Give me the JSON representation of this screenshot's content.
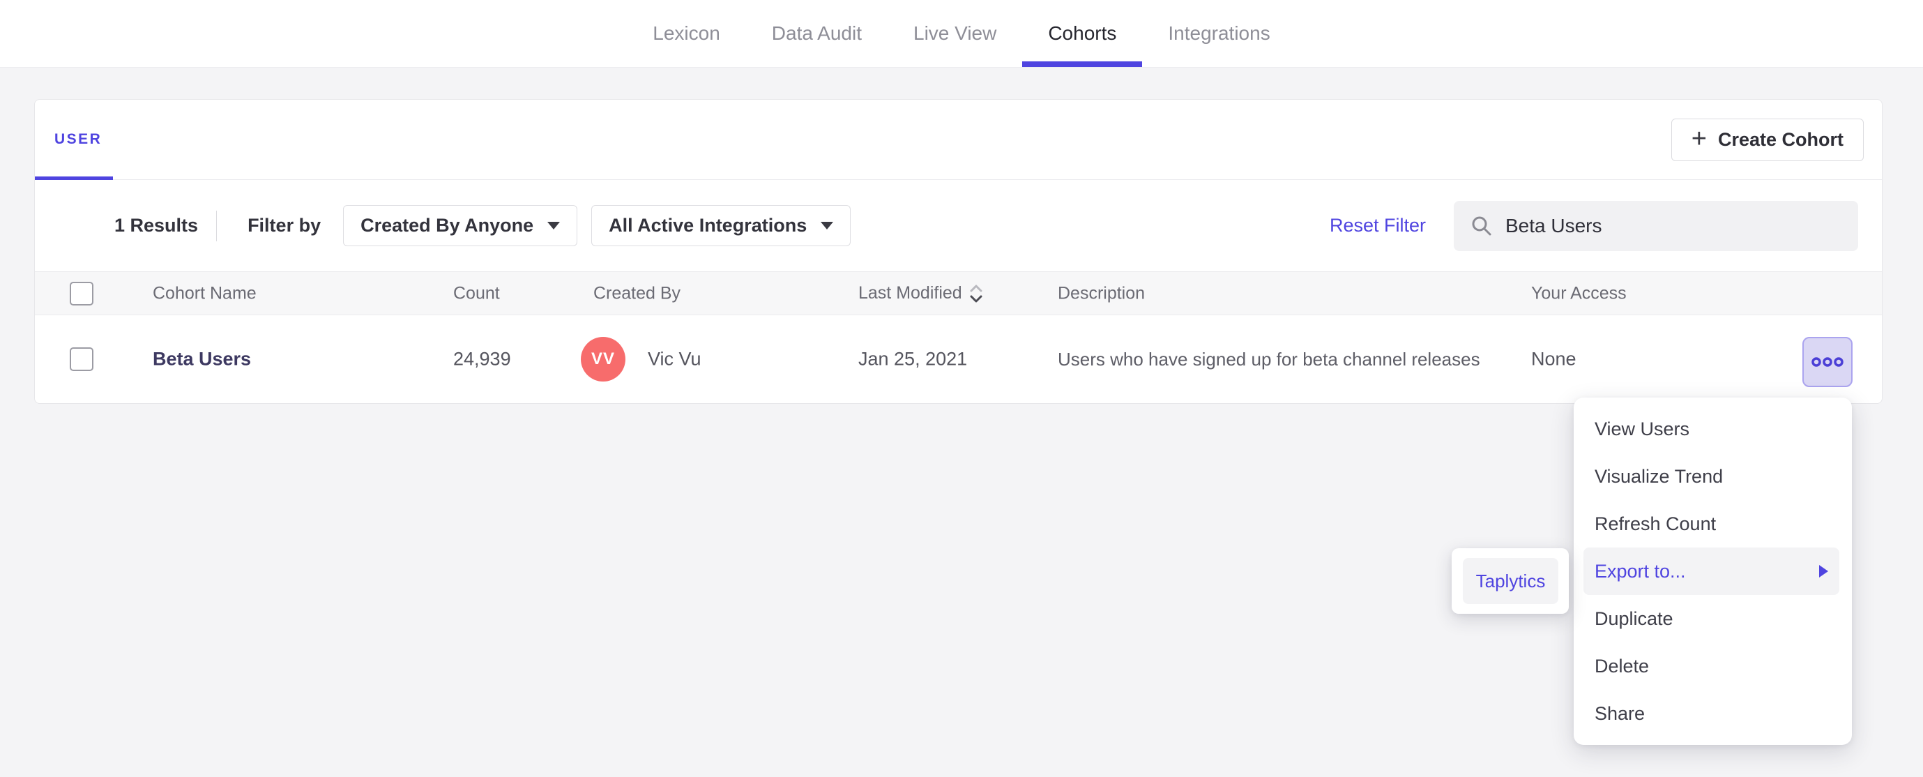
{
  "nav": {
    "tabs": [
      {
        "label": "Lexicon"
      },
      {
        "label": "Data Audit"
      },
      {
        "label": "Live View"
      },
      {
        "label": "Cohorts"
      },
      {
        "label": "Integrations"
      }
    ],
    "active_tab": "Cohorts"
  },
  "cohorts": {
    "tab_label": "USER",
    "create_button_label": "Create Cohort",
    "filters": {
      "results_count": "1 Results",
      "filter_by_label": "Filter by",
      "created_by_dropdown": "Created By Anyone",
      "integrations_dropdown": "All Active Integrations",
      "reset_filter_label": "Reset Filter",
      "search_value": "Beta Users"
    },
    "table": {
      "headers": {
        "cohort_name": "Cohort Name",
        "count": "Count",
        "created_by": "Created By",
        "last_modified": "Last Modified",
        "description": "Description",
        "your_access": "Your Access"
      },
      "rows": [
        {
          "name": "Beta Users",
          "count": "24,939",
          "avatar_initials": "VV",
          "created_by": "Vic Vu",
          "last_modified": "Jan 25, 2021",
          "description": "Users who have signed up for beta channel releases",
          "access": "None"
        }
      ]
    }
  },
  "context_menu": {
    "items": [
      "View Users",
      "Visualize Trend",
      "Refresh Count",
      "Export to...",
      "Duplicate",
      "Delete",
      "Share"
    ],
    "highlighted_item": "Export to..."
  },
  "export_submenu": {
    "items": [
      "Taplytics"
    ],
    "highlighted_item": "Taplytics"
  },
  "icons": {
    "plus": "plus",
    "chevron_down": "chevron-down",
    "search": "magnifier",
    "sort": "up-down-chevrons",
    "more": "three-outlined-dots",
    "submenu_arrow": "triangle-right"
  },
  "colors": {
    "accent": "#4f44e0",
    "avatar": "#f76c6c",
    "more_button_bg": "#dad7f4",
    "more_button_border": "#aba4ef",
    "page_bg": "#f4f4f6",
    "highlight_bg": "#f3f3f5"
  }
}
